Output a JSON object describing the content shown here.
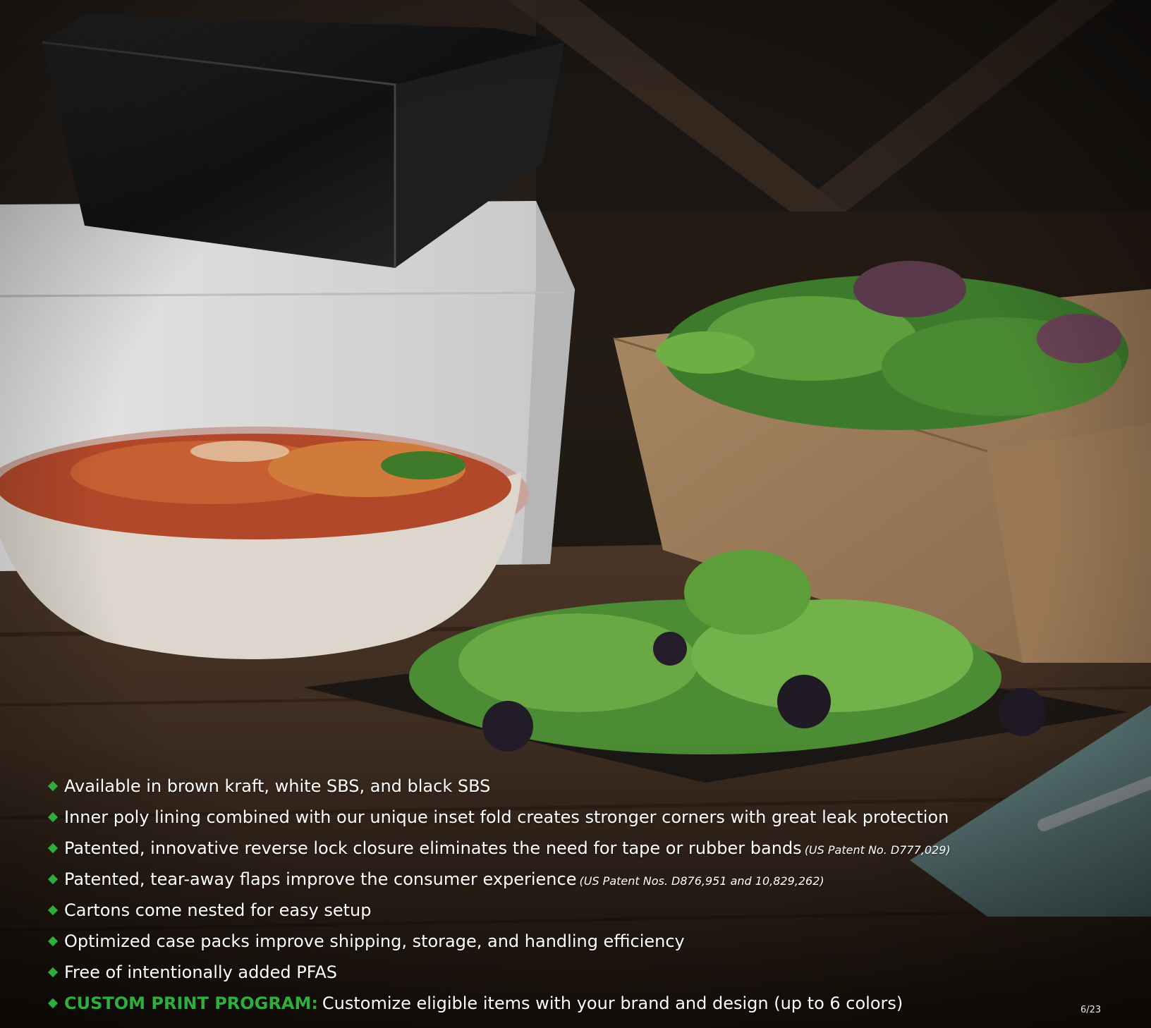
{
  "photo": {
    "subject_icon": "food-packaging-photo"
  },
  "colors": {
    "accent": "#2fae3e",
    "text": "#ffffff"
  },
  "features": [
    {
      "text": "Available in brown kraft, white SBS, and black SBS"
    },
    {
      "text": "Inner poly lining combined with our unique inset fold creates stronger corners with great leak protection"
    },
    {
      "text": "Patented, innovative reverse lock closure eliminates the need for tape or rubber bands",
      "note": "(US Patent No. D777,029)"
    },
    {
      "text": "Patented, tear-away flaps improve the consumer experience",
      "note": "(US Patent Nos. D876,951 and 10,829,262)"
    },
    {
      "text": "Cartons come nested for easy setup"
    },
    {
      "text": "Optimized case packs improve shipping, storage, and handling efficiency"
    },
    {
      "text": "Free of intentionally added PFAS"
    },
    {
      "highlight": "CUSTOM PRINT PROGRAM:",
      "text": "Customize eligible items with your brand and design (up to 6 colors)"
    }
  ],
  "page_number": "6/23"
}
